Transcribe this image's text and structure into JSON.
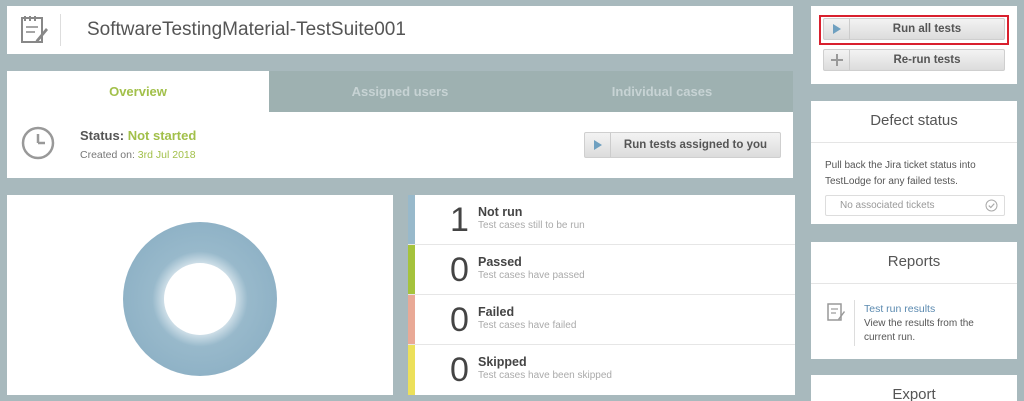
{
  "suite": {
    "title": "SoftwareTestingMaterial-TestSuite001",
    "icon": "notepad-icon"
  },
  "tabs": [
    {
      "label": "Overview",
      "active": true
    },
    {
      "label": "Assigned users",
      "active": false
    },
    {
      "label": "Individual cases",
      "active": false
    }
  ],
  "status": {
    "label": "Status:",
    "value": "Not started",
    "created_label": "Created on:",
    "created_date": "3rd Jul 2018"
  },
  "buttons": {
    "run_assigned": "Run tests assigned to you",
    "run_all": "Run all tests",
    "rerun": "Re-run tests"
  },
  "results": [
    {
      "count": "1",
      "label": "Not run",
      "desc": "Test cases still to be run",
      "color": "#98b9cb"
    },
    {
      "count": "0",
      "label": "Passed",
      "desc": "Test cases have passed",
      "color": "#a5c33c"
    },
    {
      "count": "0",
      "label": "Failed",
      "desc": "Test cases have failed",
      "color": "#e9a996"
    },
    {
      "count": "0",
      "label": "Skipped",
      "desc": "Test cases have been skipped",
      "color": "#ece05a"
    }
  ],
  "defect": {
    "title": "Defect status",
    "description": "Pull back the Jira ticket status into TestLodge for any failed tests.",
    "tickets": "No associated tickets"
  },
  "reports": {
    "title": "Reports",
    "link": "Test run results",
    "description": "View the results from the current run."
  },
  "export": {
    "title": "Export"
  },
  "colors": {
    "accent_green": "#a2c04a",
    "donut_blue": "#98b9cb",
    "highlight_red": "#d9202e"
  }
}
